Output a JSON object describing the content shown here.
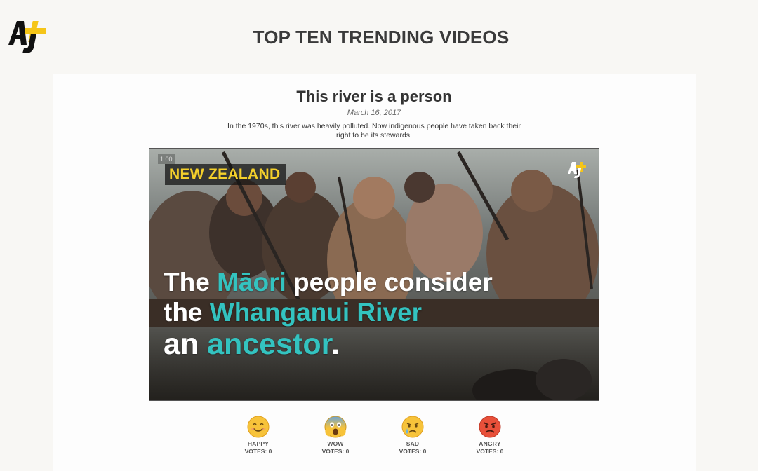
{
  "brand": {
    "logo_icon": "aj-plus-logo",
    "accent": "#f5c518"
  },
  "header": {
    "title": "TOP TEN TRENDING VIDEOS"
  },
  "video": {
    "title": "This river is a person",
    "date": "March 16, 2017",
    "description": "In the 1970s, this river was heavily polluted. Now indigenous people have taken back their right to be its stewards.",
    "player": {
      "timecode": "1:00",
      "location": "NEW ZEALAND",
      "caption": {
        "l1_a": "The ",
        "l1_b": "Māori",
        "l1_c": " people consider",
        "l2_a": "the ",
        "l2_b": "Whanganui River",
        "l3_a": "an ",
        "l3_b": "ancestor",
        "l3_c": "."
      },
      "highlight_color": "#33c3c0"
    }
  },
  "reactions": [
    {
      "icon": "happy-face-icon",
      "label": "HAPPY",
      "votes": "VOTES: 0"
    },
    {
      "icon": "wow-face-icon",
      "label": "WOW",
      "votes": "VOTES: 0"
    },
    {
      "icon": "sad-face-icon",
      "label": "SAD",
      "votes": "VOTES: 0"
    },
    {
      "icon": "angry-face-icon",
      "label": "ANGRY",
      "votes": "VOTES: 0"
    }
  ]
}
